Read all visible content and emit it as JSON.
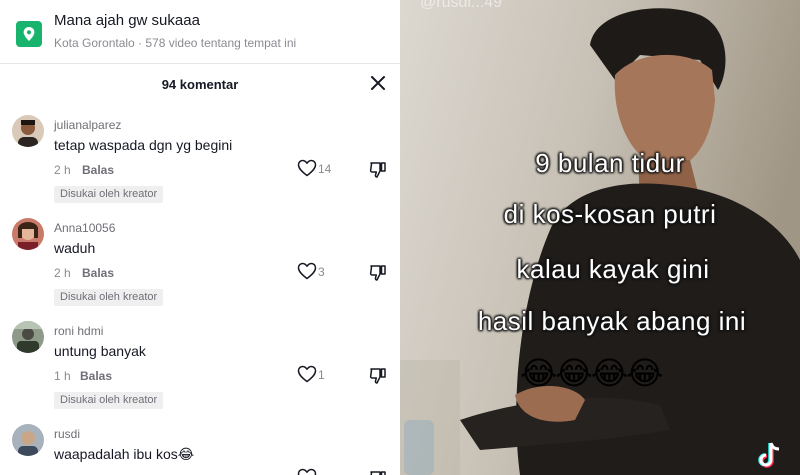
{
  "location": {
    "title": "Mana ajah gw sukaaa",
    "subtitle": "Kota Gorontalo · 578 video tentang tempat ini",
    "icon": "map-pin-icon",
    "icon_color": "#18b36c"
  },
  "comments_panel": {
    "count_label": "94 komentar",
    "close_icon": "close-icon"
  },
  "comments": [
    {
      "username": "julianalparez",
      "text": "tetap waspada dgn yg begini",
      "time": "2 h",
      "reply_label": "Balas",
      "likes": "14",
      "liked_by_creator": "Disukai oleh kreator"
    },
    {
      "username": "Anna10056",
      "text": "waduh",
      "time": "2 h",
      "reply_label": "Balas",
      "likes": "3",
      "liked_by_creator": "Disukai oleh kreator"
    },
    {
      "username": "roni hdmi",
      "text": "untung banyak",
      "time": "1 h",
      "reply_label": "Balas",
      "likes": "1",
      "liked_by_creator": "Disukai oleh kreator"
    },
    {
      "username": "rusdi",
      "text": "waapadalah ibu kos😂",
      "time": "",
      "reply_label": "",
      "likes": "",
      "liked_by_creator": ""
    }
  ],
  "video": {
    "watermark": "@rusdi...49",
    "caption_lines": [
      "9 bulan tidur",
      "di kos-kosan putri",
      "kalau kayak gini",
      "hasil banyak abang ini"
    ],
    "emojis": "😂😂😂😂",
    "logo_icon": "tiktok-logo-icon"
  },
  "colors": {
    "accent": "#18b36c",
    "text_primary": "#161823",
    "text_secondary": "#8a8b91"
  }
}
